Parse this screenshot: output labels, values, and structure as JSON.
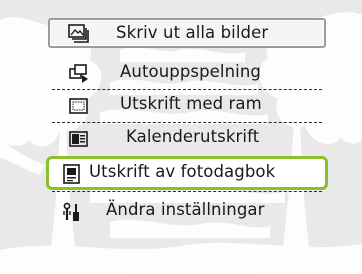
{
  "menu": {
    "items": [
      {
        "label": "Skriv ut alla bilder",
        "icon": "print-all-icon",
        "selected": false,
        "framed": true
      },
      {
        "label": "Autouppspelning",
        "icon": "autoplay-icon",
        "selected": false
      },
      {
        "label": "Utskrift med ram",
        "icon": "frame-print-icon",
        "selected": false
      },
      {
        "label": "Kalenderutskrift",
        "icon": "calendar-print-icon",
        "selected": false
      },
      {
        "label": "Utskrift av fotodagbok",
        "icon": "photo-diary-icon",
        "selected": true
      },
      {
        "label": "Ändra inställningar",
        "icon": "settings-icon",
        "selected": false
      }
    ],
    "selected_index": 4
  },
  "colors": {
    "background": "#ebebeb",
    "tree_silhouette": "#ffffff",
    "selection_border": "#8dc026",
    "text": "#1a1a1a"
  }
}
